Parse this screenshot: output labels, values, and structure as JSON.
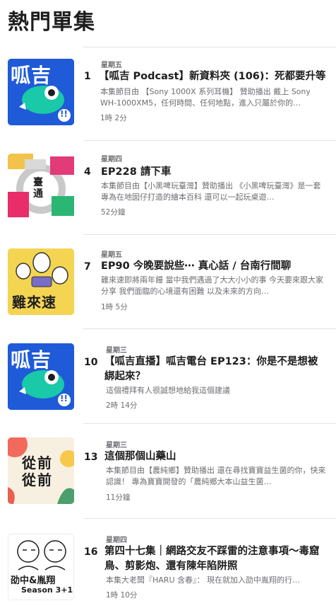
{
  "header": {
    "title": "熱門單集"
  },
  "episodes": [
    {
      "rank": "1",
      "day": "星期五",
      "title": "【呱吉 Podcast】新資料夾 (106)：死都要升等",
      "desc": "本集節目由 【Sony 1000X 系列耳機】 贊助播出 戴上 Sony WH-1000XM5，任何時間、任何地點，進入只屬於你的…",
      "duration": "1時 2分",
      "art_text": "呱吉",
      "art_badge": "!!"
    },
    {
      "rank": "4",
      "day": "星期四",
      "title": "EP228 請下車",
      "desc": "本集節目由【小黑啤玩臺灣】贊助播出 《小黑啤玩臺灣》是一套專為在地囡仔打造的繪本百科 還可以一起玩桌遊…",
      "duration": "52分鐘",
      "art_text": "臺通"
    },
    {
      "rank": "7",
      "day": "星期五",
      "title": "EP90 今晚要說些⋯ 真心話 / 台南行間聊",
      "desc": "雞來速即將兩年饅 當中我們遇過了大大小小的事 今天要來跟大家分享 我們面臨的心境還有困難 以及未來的方向…",
      "duration": "1時 5分",
      "art_text": "雞來速"
    },
    {
      "rank": "10",
      "day": "星期三",
      "title": "【呱吉直播】呱吉電台 EP123：你是不是想被綁起來？",
      "desc": "這個禮拜有人很誠想地給我這個建議",
      "duration": "2時 14分",
      "art_text": "呱吉",
      "art_badge": "!!"
    },
    {
      "rank": "13",
      "day": "星期三",
      "title": "這個那個山藥山",
      "desc": "本集節目由【農純鄉】贊助播出 還在尋找寶寶益生菌的你，快來認識！ 專為寶寶開發的「農純鄉大本山益生菌…",
      "duration": "11分鐘",
      "art_text": "從前從前"
    },
    {
      "rank": "16",
      "day": "星期四",
      "title": "第四十七集｜網路交友不踩雷的注意事項～毒窟鳥、剪影炮、還有陳年陷阱照",
      "desc": "本集大老闆『HARU 含春』： 現在就加入劭中胤翔的行…",
      "duration": "1時 10分",
      "art_text": "劭中&胤翔",
      "art_sub": "Season 3+1"
    }
  ]
}
